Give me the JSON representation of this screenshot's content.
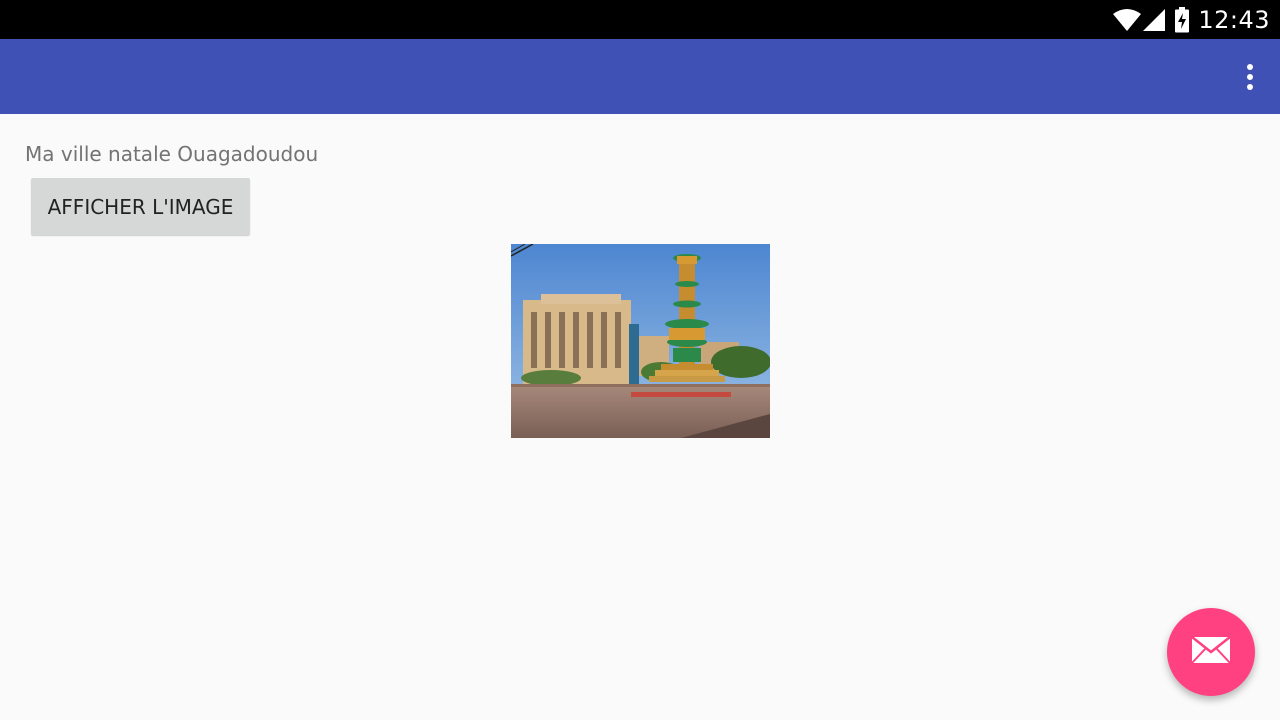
{
  "status_bar": {
    "time": "12:43",
    "icons": [
      "wifi-icon",
      "cell-signal-icon",
      "battery-charging-icon"
    ]
  },
  "app_bar": {
    "overflow_icon": "more-vert-icon"
  },
  "main": {
    "intro_text": "Ma ville natale Ouagadoudou",
    "button_label": "AFFICHER L'IMAGE",
    "image": "city-photo"
  },
  "fab": {
    "icon": "mail-icon"
  },
  "colors": {
    "app_bar": "#3f51b5",
    "fab": "#ff4081",
    "background": "#fafafa",
    "status_bar": "#000000"
  }
}
